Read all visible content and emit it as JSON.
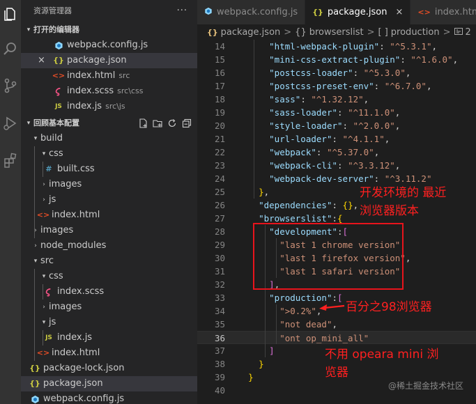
{
  "explorer": {
    "title": "资源管理器",
    "more_label": "···",
    "open_editors": {
      "label": "打开的编辑器",
      "items": [
        {
          "name": "webpack.config.js",
          "desc": "",
          "icon": "webpack-icon"
        },
        {
          "name": "package.json",
          "desc": "",
          "icon": "json-icon",
          "close": "×"
        },
        {
          "name": "index.html",
          "desc": "src",
          "icon": "html-icon"
        },
        {
          "name": "index.scss",
          "desc": "src\\css",
          "icon": "scss-icon"
        },
        {
          "name": "index.js",
          "desc": "src\\js",
          "icon": "js-icon"
        }
      ]
    },
    "workspace": {
      "label": "回顾基本配置",
      "tree": [
        {
          "name": "build"
        },
        {
          "name": "css"
        },
        {
          "name": "built.css"
        },
        {
          "name": "images"
        },
        {
          "name": "js"
        },
        {
          "name": "index.html"
        },
        {
          "name": "images"
        },
        {
          "name": "node_modules"
        },
        {
          "name": "src"
        },
        {
          "name": "css"
        },
        {
          "name": "index.scss"
        },
        {
          "name": "images"
        },
        {
          "name": "js"
        },
        {
          "name": "index.js"
        },
        {
          "name": "index.html"
        },
        {
          "name": "package-lock.json"
        },
        {
          "name": "package.json"
        },
        {
          "name": "webpack.config.js"
        }
      ]
    }
  },
  "tabs": [
    {
      "label": "webpack.config.js",
      "icon": "webpack-icon"
    },
    {
      "label": "package.json",
      "icon": "json-icon",
      "close": "×"
    },
    {
      "label": "index.html",
      "icon": "html-icon"
    }
  ],
  "breadcrumb": {
    "file": "package.json",
    "sep": ">",
    "obj": "browserslist",
    "arr": "production",
    "item": "2",
    "obj_glyph": "{}",
    "arr_glyph": "[ ]",
    "brace_glyph": "{}"
  },
  "glyphs": {
    "js": "JS",
    "hash": "#",
    "html": "<>",
    "chev_open": "▾",
    "chev_closed": "›",
    "chev_section": "▾"
  },
  "editor": {
    "current_line": "36",
    "lines": [
      {
        "n": "14",
        "t": "      \"html-webpack-plugin\": \"^5.3.1\","
      },
      {
        "n": "15",
        "t": "      \"mini-css-extract-plugin\": \"^1.6.0\","
      },
      {
        "n": "16",
        "t": "      \"postcss-loader\": \"^5.3.0\","
      },
      {
        "n": "17",
        "t": "      \"postcss-preset-env\": \"^6.7.0\","
      },
      {
        "n": "18",
        "t": "      \"sass\": \"^1.32.12\","
      },
      {
        "n": "19",
        "t": "      \"sass-loader\": \"^11.1.0\","
      },
      {
        "n": "20",
        "t": "      \"style-loader\": \"^2.0.0\","
      },
      {
        "n": "21",
        "t": "      \"url-loader\": \"^4.1.1\","
      },
      {
        "n": "22",
        "t": "      \"webpack\": \"^5.37.0\","
      },
      {
        "n": "23",
        "t": "      \"webpack-cli\": \"^3.3.12\","
      },
      {
        "n": "24",
        "t": "      \"webpack-dev-server\": \"^3.11.2\""
      },
      {
        "n": "25",
        "t": "    },"
      },
      {
        "n": "26",
        "t": "    \"dependencies\": {},"
      },
      {
        "n": "27",
        "t": "    \"browserslist\":{"
      },
      {
        "n": "28",
        "t": "      \"development\":["
      },
      {
        "n": "29",
        "t": "        \"last 1 chrome version\","
      },
      {
        "n": "30",
        "t": "        \"last 1 firefox version\","
      },
      {
        "n": "31",
        "t": "        \"last 1 safari version\""
      },
      {
        "n": "32",
        "t": "      ],"
      },
      {
        "n": "33",
        "t": "      \"production\":["
      },
      {
        "n": "34",
        "t": "        \">0.2%\","
      },
      {
        "n": "35",
        "t": "        \"not dead\","
      },
      {
        "n": "36",
        "t": "        \"ont op_mini_all\""
      },
      {
        "n": "37",
        "t": "      ]"
      },
      {
        "n": "38",
        "t": "    }"
      },
      {
        "n": "39",
        "t": "  }"
      },
      {
        "n": "40",
        "t": ""
      }
    ]
  },
  "annotations": {
    "dev_line1": "开发环境的 最近",
    "dev_line2": "浏览器版本",
    "prod_pct": "百分之98浏览器",
    "no_opera_line1": "不用 opeara mini 浏",
    "no_opera_line2": "览器"
  },
  "watermark": "@稀土掘金技术社区",
  "colors": {
    "annotation": "#ff2020",
    "key": "#9cdcfe",
    "string": "#ce9178",
    "bracket": "#ffd700"
  }
}
